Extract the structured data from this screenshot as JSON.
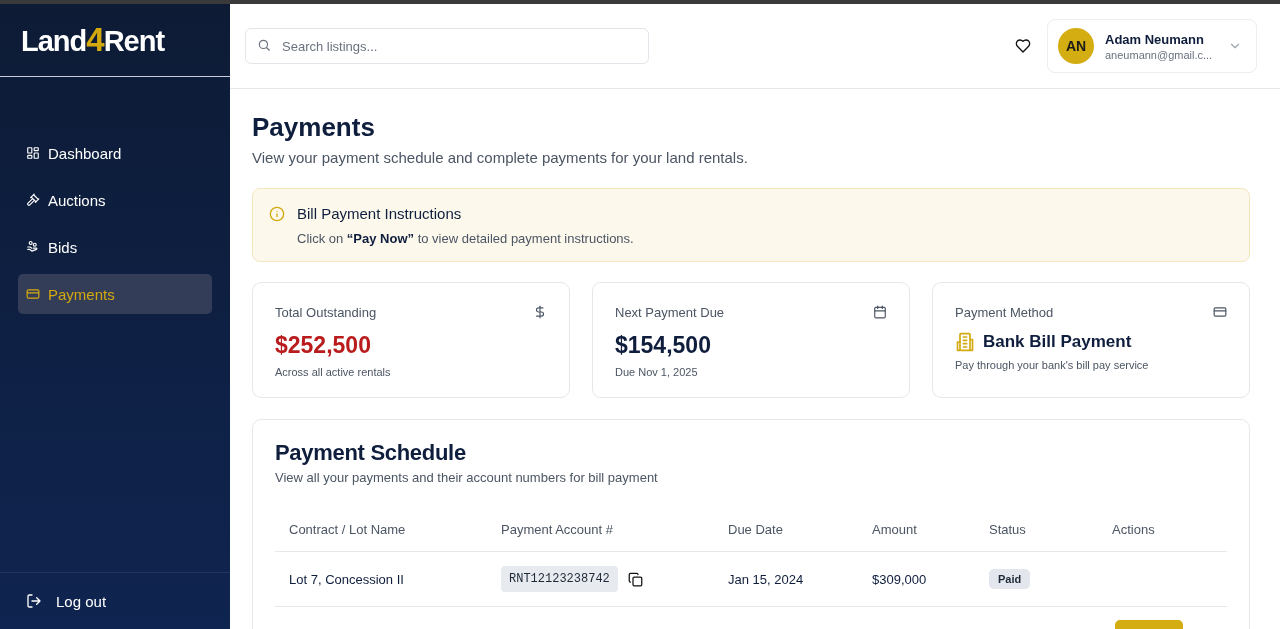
{
  "logo": {
    "parts": [
      "Land",
      "4",
      "Rent"
    ]
  },
  "sidebar": {
    "items": [
      {
        "label": "Dashboard",
        "selected": false
      },
      {
        "label": "Auctions",
        "selected": false
      },
      {
        "label": "Bids",
        "selected": false
      },
      {
        "label": "Payments",
        "selected": true
      }
    ],
    "logout": "Log out"
  },
  "header": {
    "search": {
      "placeholder": "Search listings..."
    },
    "user": {
      "initials": "AN",
      "name": "Adam Neumann",
      "email": "aneumann@gmail.c..."
    }
  },
  "page": {
    "title": "Payments",
    "subtitle": "View your payment schedule and complete payments for your land rentals."
  },
  "alert": {
    "title": "Bill Payment Instructions",
    "text": "Click on **“Pay Now”** to view detailed payment instructions."
  },
  "stats": [
    {
      "label": "Total Outstanding",
      "value": "$252,500",
      "kind": "alert",
      "note": "Across all active rentals"
    },
    {
      "label": "Next Payment Due",
      "value": "$154,500",
      "kind": "amount",
      "note": "Due Nov 1, 2025"
    },
    {
      "label": "Payment Method",
      "value": "Bank Bill Payment",
      "kind": "method",
      "note": "Pay through your bank's bill pay service"
    }
  ],
  "schedule": {
    "title": "Payment Schedule",
    "subtitle": "View all your payments and their account numbers for bill payment",
    "columns": [
      "Contract / Lot Name",
      "Payment Account #",
      "Due Date",
      "Amount",
      "Status",
      "Actions"
    ],
    "rows": [
      {
        "lot": "Lot 7, Concession II",
        "account": "RNT12123238742",
        "due": "Jan 15, 2024",
        "amount": "$309,000",
        "status": "Paid",
        "kind": "paid"
      }
    ]
  }
}
